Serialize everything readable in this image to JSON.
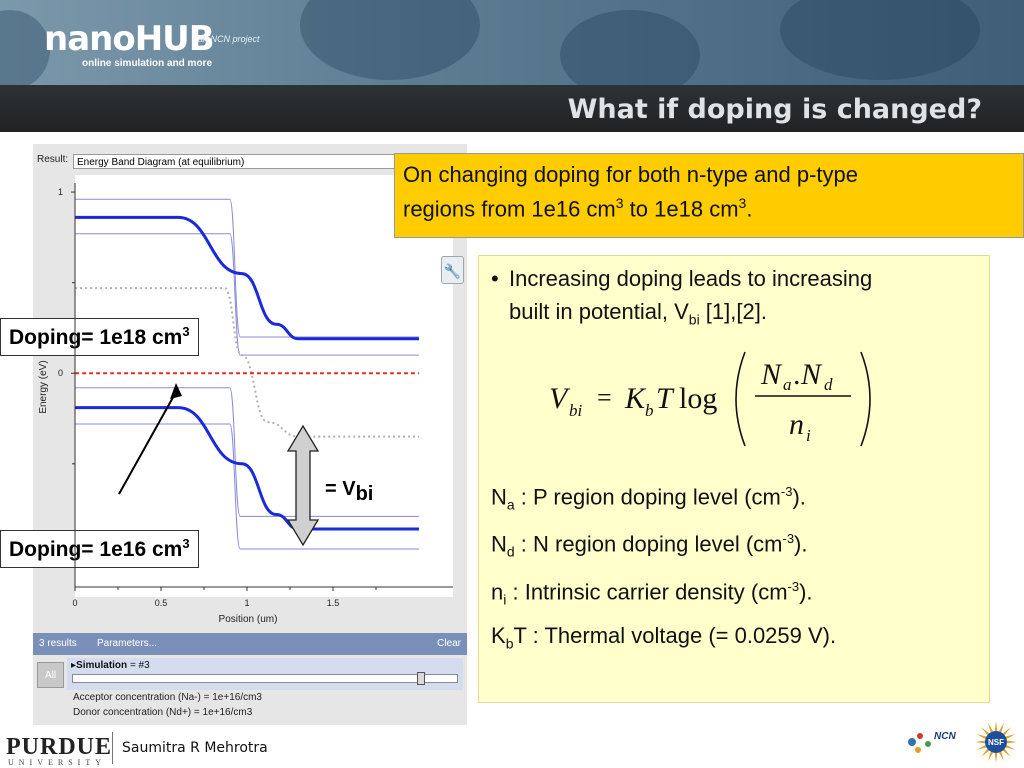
{
  "header": {
    "logo": "nanoHUB",
    "tagline": "online simulation and more",
    "ncn_project": "an NCN project",
    "slide_title": "What if doping is changed?"
  },
  "app": {
    "result_label": "Result:",
    "result_value": "Energy Band Diagram (at equilibrium)",
    "results_count": "3 results",
    "parameters_link": "Parameters...",
    "clear_button": "Clear",
    "all_button": "All",
    "simulation_label": "Simulation",
    "simulation_value": "= #3",
    "acceptor_line": "Acceptor concentration (Na-) = 1e+16/cm3",
    "donor_line": "Donor concentration (Nd+) = 1e+16/cm3",
    "slider_fraction": 0.91
  },
  "chart_data": {
    "type": "line",
    "title": "",
    "xlabel": "Position (um)",
    "ylabel": "Energy (eV)",
    "xlim": [
      0,
      2.0
    ],
    "ylim": [
      -1.18,
      1.05
    ],
    "x_ticks": [
      "0",
      "0.5",
      "1",
      "1.5"
    ],
    "y_ticks": [
      "1",
      "0"
    ],
    "grid": false,
    "series": [
      {
        "role": "Ec-high-doping",
        "style": "blue-thick",
        "x": [
          0,
          0.6,
          0.97,
          1.17,
          1.3,
          2.0
        ],
        "y": [
          0.86,
          0.86,
          0.55,
          0.27,
          0.19,
          0.19
        ]
      },
      {
        "role": "Ec-low-doping",
        "style": "blue-thick",
        "x": [
          0,
          0.6,
          0.97,
          1.17,
          1.3,
          2.0
        ],
        "y": [
          -0.19,
          -0.19,
          -0.5,
          -0.78,
          -0.86,
          -0.86
        ]
      },
      {
        "role": "Ec-faint-upper",
        "style": "faint",
        "x": [
          0,
          0.9,
          0.96,
          2.0
        ],
        "y": [
          0.96,
          0.96,
          0.2,
          0.2
        ]
      },
      {
        "role": "Ec-faint-lower",
        "style": "faint",
        "x": [
          0,
          0.9,
          0.96,
          2.0
        ],
        "y": [
          0.77,
          0.77,
          0.1,
          0.1
        ]
      },
      {
        "role": "Ev-faint-upper",
        "style": "faint",
        "x": [
          0,
          0.9,
          0.96,
          2.0
        ],
        "y": [
          -0.08,
          -0.08,
          -0.79,
          -0.79
        ]
      },
      {
        "role": "Ev-faint-lower",
        "style": "faint",
        "x": [
          0,
          0.9,
          0.96,
          2.0
        ],
        "y": [
          -0.28,
          -0.28,
          -0.97,
          -0.97
        ]
      },
      {
        "role": "Ef",
        "style": "red-dashed",
        "x": [
          0,
          2.0
        ],
        "y": [
          0,
          0
        ]
      },
      {
        "role": "mid-gap",
        "style": "gray-dotted",
        "x": [
          0,
          0.87,
          0.97,
          1.12,
          1.3,
          2.0
        ],
        "y": [
          0.47,
          0.47,
          0.1,
          -0.27,
          -0.35,
          -0.35
        ]
      }
    ]
  },
  "statement": {
    "line1": "On changing doping for both n-type and p-type",
    "line2_a": "regions from 1e16 cm",
    "line2_sup1": "3",
    "line2_b": " to 1e18 cm",
    "line2_sup2": "3",
    "line2_c": "."
  },
  "notes": {
    "bullet": "•",
    "bullet_line1": "Increasing doping leads to increasing",
    "bullet_line2_a": "built in potential, V",
    "bullet_line2_sub": "bi",
    "bullet_line2_b": " [1],[2].",
    "formula": {
      "lhs": "V",
      "lhs_sub": "bi",
      "eq": "=",
      "k": "K",
      "k_sub": "b",
      "t": "T",
      "log": "log",
      "num_a": "N",
      "num_a_sub": "a",
      "dot": ".",
      "num_b": "N",
      "num_b_sub": "d",
      "den": "n",
      "den_sub": "i"
    },
    "na_sym": "N",
    "na_sub": "a",
    "na_text": " : P region doping level (cm",
    "nd_sym": "N",
    "nd_sub": "d",
    "nd_text": " : N region doping level (cm",
    "ni_sym": "n",
    "ni_sub": "i",
    "ni_text": " : Intrinsic carrier density (cm",
    "exp": "-3",
    "close": ").",
    "kbt_sym": "K",
    "kbt_sub": "b",
    "kbt_text": "T : Thermal voltage (= 0.0259 V)."
  },
  "callouts": {
    "high_a": "Doping= 1e18 cm",
    "high_sup": "3",
    "low_a": "Doping= 1e16 cm",
    "low_sup": "3",
    "vbi_eq": "= V",
    "vbi_sub": "bi"
  },
  "footer": {
    "university": "PURDUE",
    "university_sub": "UNIVERSITY",
    "author": "Saumitra R Mehrotra",
    "ncn": "NCN",
    "nsf": "NSF"
  }
}
